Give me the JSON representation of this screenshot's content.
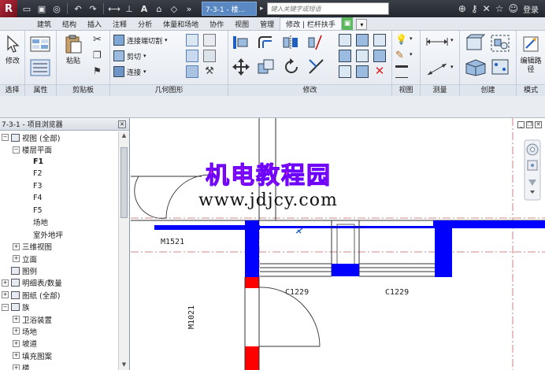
{
  "titlebar": {
    "app_logo": "R",
    "doc_title": "7-3-1 - 楼...",
    "search_placeholder": "键入关键字或短语",
    "login": "登录"
  },
  "ribbon_tabs": [
    {
      "label": "建筑"
    },
    {
      "label": "结构"
    },
    {
      "label": "插入"
    },
    {
      "label": "注释"
    },
    {
      "label": "分析"
    },
    {
      "label": "体量和场地"
    },
    {
      "label": "协作"
    },
    {
      "label": "视图"
    },
    {
      "label": "管理"
    },
    {
      "label": "修改 | 栏杆扶手",
      "active": true
    }
  ],
  "ribbon": {
    "select": {
      "button": "修改",
      "panel": "选择"
    },
    "properties": {
      "panel": "属性"
    },
    "clipboard": {
      "paste": "粘贴",
      "panel": "剪贴板"
    },
    "geometry": {
      "join_cut": "连接端切割",
      "cut": "剪切",
      "join": "连接",
      "panel": "几何图形"
    },
    "modify": {
      "panel": "修改"
    },
    "view": {
      "panel": "视图"
    },
    "measure": {
      "panel": "测量"
    },
    "create": {
      "panel": "创建"
    },
    "mode": {
      "edit_path": "编辑路径",
      "panel": "模式"
    }
  },
  "browser": {
    "title": "7-3-1 - 项目浏览器",
    "rows": [
      {
        "label": "视图 (全部)",
        "indent": 0,
        "expander": "−"
      },
      {
        "label": "楼层平面",
        "indent": 1,
        "expander": "−"
      },
      {
        "label": "F1",
        "indent": 2,
        "bold": true
      },
      {
        "label": "F2",
        "indent": 2
      },
      {
        "label": "F3",
        "indent": 2
      },
      {
        "label": "F4",
        "indent": 2
      },
      {
        "label": "F5",
        "indent": 2
      },
      {
        "label": "场地",
        "indent": 2
      },
      {
        "label": "室外地坪",
        "indent": 2
      },
      {
        "label": "三维视图",
        "indent": 1,
        "expander": "+"
      },
      {
        "label": "立面",
        "indent": 1,
        "expander": "+"
      },
      {
        "label": "图例",
        "indent": 0,
        "icon": true
      },
      {
        "label": "明细表/数量",
        "indent": 0,
        "expander": "+",
        "icon": true
      },
      {
        "label": "图纸 (全部)",
        "indent": 0,
        "expander": "+",
        "icon": true
      },
      {
        "label": "族",
        "indent": 0,
        "expander": "−",
        "icon": true
      },
      {
        "label": "卫浴装置",
        "indent": 1,
        "expander": "+"
      },
      {
        "label": "场地",
        "indent": 1,
        "expander": "+"
      },
      {
        "label": "坡道",
        "indent": 1,
        "expander": "+"
      },
      {
        "label": "填充图案",
        "indent": 1,
        "expander": "+"
      },
      {
        "label": "楼",
        "indent": 1,
        "expander": "+"
      }
    ]
  },
  "canvas": {
    "watermark_cn": "机电教程园",
    "watermark_url": "www.jdjcy.com",
    "tags": {
      "door1": "M1521",
      "window1": "C1229",
      "window2": "C1229",
      "door2": "M1021"
    }
  },
  "colors": {
    "wall": "#0000ff",
    "column": "#ff0000",
    "ribbon_context_tab": "#5cb85c",
    "watermark": "#ff2fb0"
  }
}
